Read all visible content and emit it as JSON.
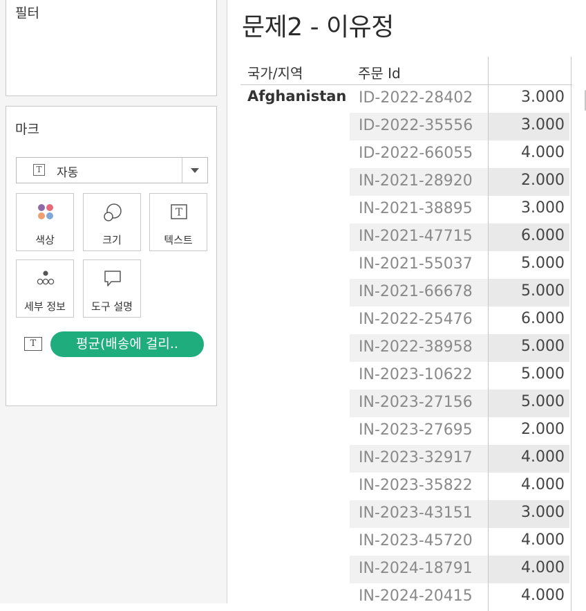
{
  "left_pane": {
    "filters": {
      "title": "필터"
    },
    "marks": {
      "title": "마크",
      "mark_type": {
        "icon": "text-icon",
        "label": "자동"
      },
      "buttons": [
        {
          "name": "color-button",
          "label": "색상",
          "icon": "color-icon",
          "colors": [
            "#8e6aa8",
            "#e8697a",
            "#f0a070",
            "#7fa8d8"
          ]
        },
        {
          "name": "size-button",
          "label": "크기",
          "icon": "size-icon"
        },
        {
          "name": "text-button",
          "label": "텍스트",
          "icon": "text-icon"
        },
        {
          "name": "detail-button",
          "label": "세부 정보",
          "icon": "detail-icon"
        },
        {
          "name": "tooltip-button",
          "label": "도구 설명",
          "icon": "tooltip-icon"
        }
      ],
      "pill": {
        "icon": "text-icon",
        "label": "평균(배송에 걸리..",
        "color": "#1fad7e"
      }
    }
  },
  "sheet": {
    "title": "문제2 - 이유정",
    "columns": [
      "국가/지역",
      "주문 Id"
    ],
    "country": "Afghanistan",
    "rows": [
      {
        "order_id": "ID-2022-28402",
        "value": "3.000"
      },
      {
        "order_id": "ID-2022-35556",
        "value": "3.000"
      },
      {
        "order_id": "ID-2022-66055",
        "value": "4.000"
      },
      {
        "order_id": "IN-2021-28920",
        "value": "2.000"
      },
      {
        "order_id": "IN-2021-38895",
        "value": "3.000"
      },
      {
        "order_id": "IN-2021-47715",
        "value": "6.000"
      },
      {
        "order_id": "IN-2021-55037",
        "value": "5.000"
      },
      {
        "order_id": "IN-2021-66678",
        "value": "5.000"
      },
      {
        "order_id": "IN-2022-25476",
        "value": "6.000"
      },
      {
        "order_id": "IN-2022-38958",
        "value": "5.000"
      },
      {
        "order_id": "IN-2023-10622",
        "value": "5.000"
      },
      {
        "order_id": "IN-2023-27156",
        "value": "5.000"
      },
      {
        "order_id": "IN-2023-27695",
        "value": "2.000"
      },
      {
        "order_id": "IN-2023-32917",
        "value": "4.000"
      },
      {
        "order_id": "IN-2023-35822",
        "value": "4.000"
      },
      {
        "order_id": "IN-2023-43151",
        "value": "3.000"
      },
      {
        "order_id": "IN-2023-45720",
        "value": "4.000"
      },
      {
        "order_id": "IN-2024-18791",
        "value": "4.000"
      },
      {
        "order_id": "IN-2024-20415",
        "value": "4.000"
      }
    ]
  }
}
